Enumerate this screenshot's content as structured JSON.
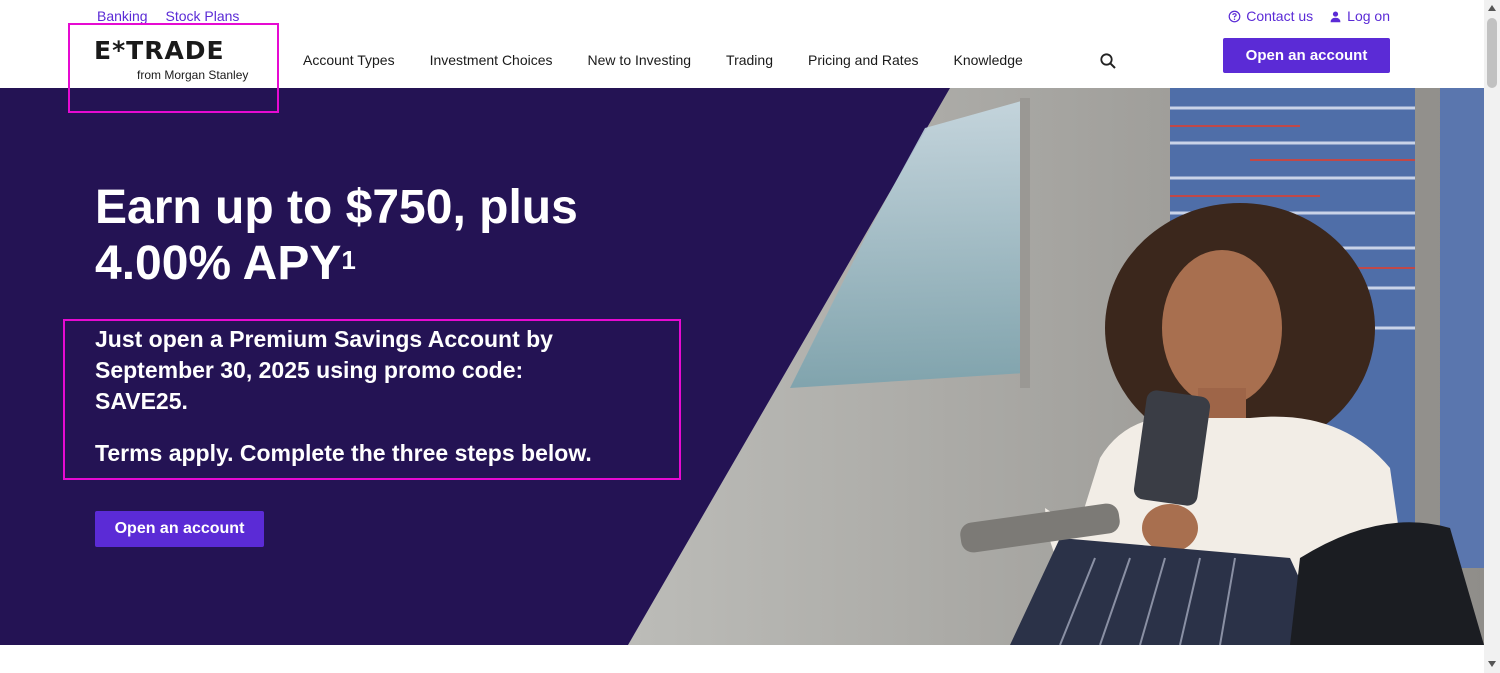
{
  "utility": {
    "banking": "Banking",
    "stock_plans": "Stock Plans",
    "contact_us": "Contact us",
    "log_on": "Log on"
  },
  "logo": {
    "main": "E*TRADE",
    "sub": "from Morgan Stanley"
  },
  "nav": {
    "items": [
      "Account Types",
      "Investment Choices",
      "New to Investing",
      "Trading",
      "Pricing and Rates",
      "Knowledge"
    ]
  },
  "header_cta": "Open an account",
  "hero": {
    "headline_line1": "Earn up to $750, plus",
    "headline_line2": "4.00% APY",
    "footnote": "1",
    "sub_line1": "Just open a Premium Savings Account by",
    "sub_line2": "September 30, 2025 using promo code:",
    "promo_code": "SAVE25.",
    "terms": "Terms apply. Complete the three steps below.",
    "cta": "Open an account"
  },
  "colors": {
    "brand_purple": "#5b2bd6",
    "hero_bg": "#241354",
    "highlight": "#e60ad2"
  },
  "icons": [
    "help-circle-icon",
    "user-icon",
    "search-icon"
  ]
}
